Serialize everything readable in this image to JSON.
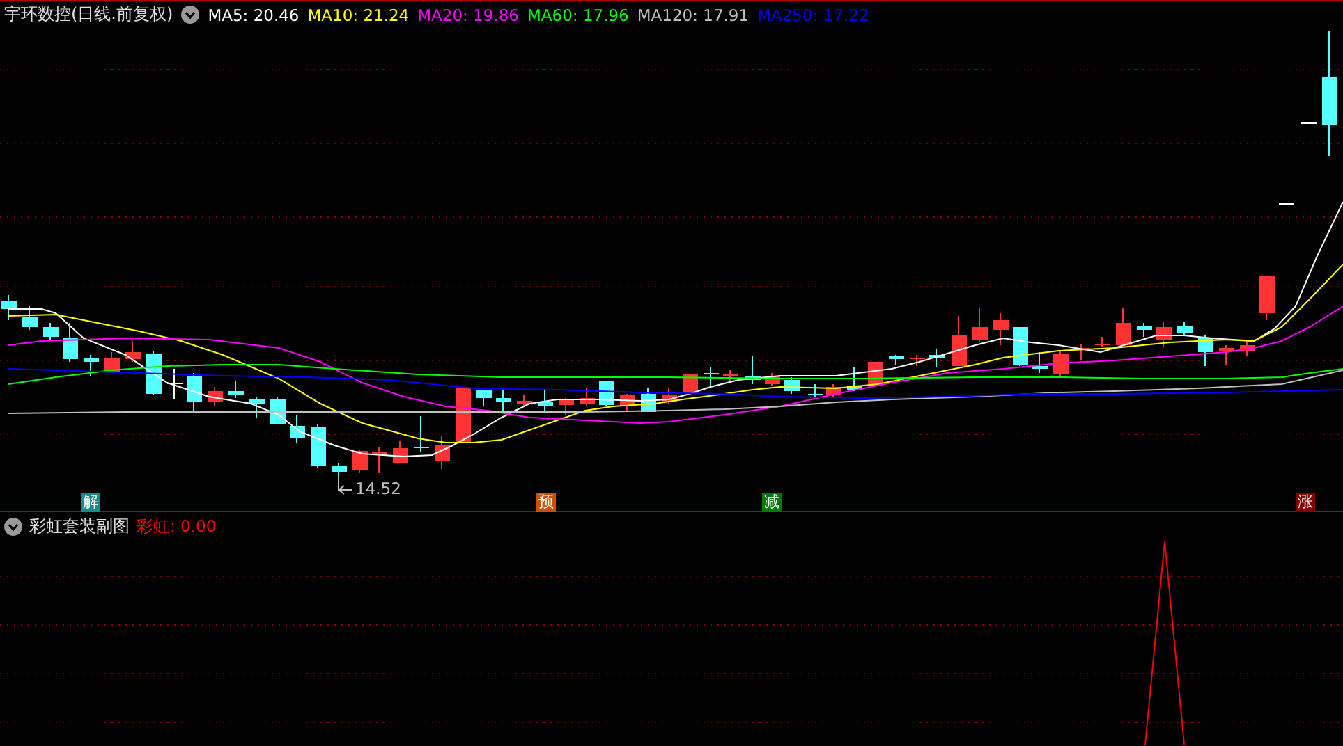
{
  "main_chart": {
    "title": "宇环数控(日线.前复权)",
    "indicators": [
      {
        "label": "MA5: 20.46",
        "color": "#ffffff"
      },
      {
        "label": "MA10: 21.24",
        "color": "#ffff00"
      },
      {
        "label": "MA20: 19.86",
        "color": "#ff00ff"
      },
      {
        "label": "MA60: 17.96",
        "color": "#00ff00"
      },
      {
        "label": "MA120: 17.91",
        "color": "#c0c0c0"
      },
      {
        "label": "MA250: 17.22",
        "color": "#0000ff"
      }
    ],
    "low_label": "14.52",
    "signals": [
      {
        "label": "解",
        "color": "#1a8a8a"
      },
      {
        "label": "预",
        "color": "#c85000"
      },
      {
        "label": "减",
        "color": "#007a00"
      },
      {
        "label": "涨",
        "color": "#800000"
      }
    ]
  },
  "sub_chart": {
    "title": "彩虹套装副图",
    "indicators": [
      {
        "label": "彩虹: 0.00",
        "color": "#ff0000"
      }
    ]
  }
}
